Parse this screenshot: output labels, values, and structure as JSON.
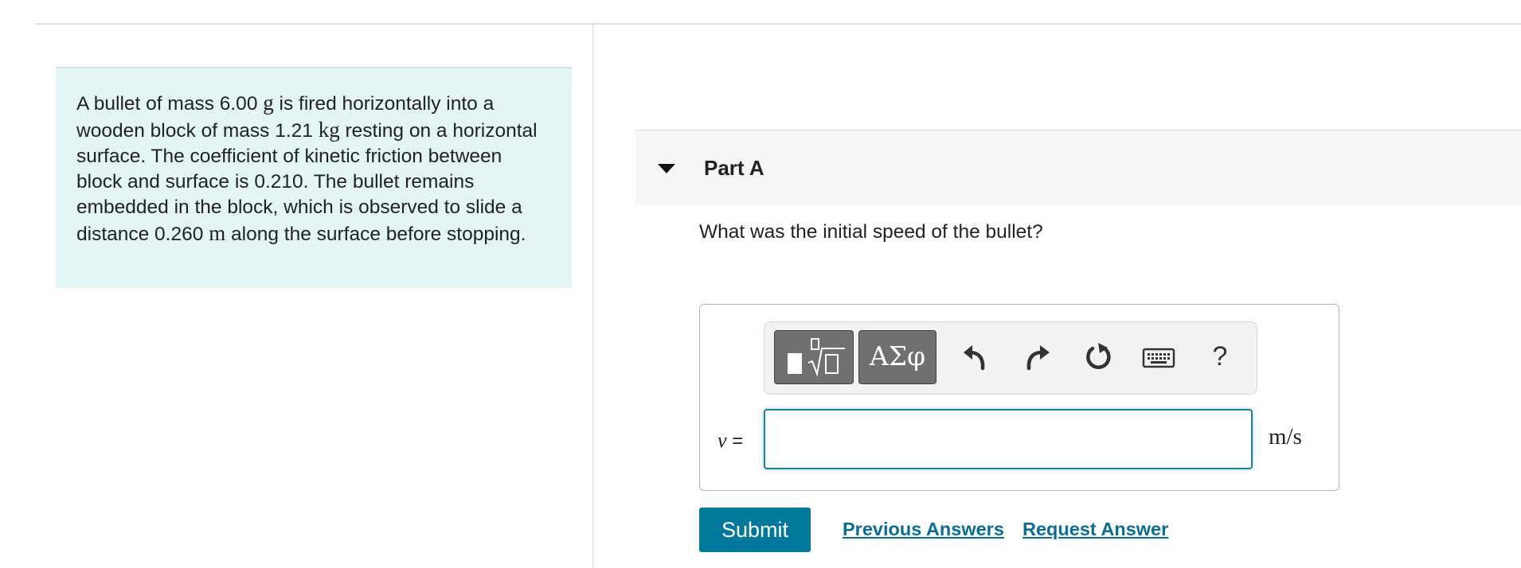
{
  "problem": {
    "seg1": "A bullet of mass 6.00 ",
    "unit_g": "g",
    "seg2": " is fired horizontally into a wooden block of mass 1.21 ",
    "unit_kg": "kg",
    "seg3": " resting on a horizontal surface. The coefficient of kinetic friction between block and surface is 0.210. The bullet remains embedded in the block, which is observed to slide a distance 0.260 ",
    "unit_m": "m",
    "seg4": " along the surface before stopping."
  },
  "part": {
    "title": "Part A",
    "question": "What was the initial speed of the bullet?"
  },
  "toolbar": {
    "symbols_label": "ΑΣφ",
    "help_label": "?",
    "icons": [
      "templates-icon",
      "undo-icon",
      "redo-icon",
      "reset-icon",
      "keyboard-icon"
    ]
  },
  "answer": {
    "variable": "v",
    "equals": "=",
    "value": "",
    "units": "m/s"
  },
  "actions": {
    "submit_label": "Submit",
    "previous_answers_label": "Previous Answers",
    "request_answer_label": "Request Answer"
  },
  "colors": {
    "problem_bg": "#e4f5f5",
    "accent": "#00789d",
    "link": "#0a6d96",
    "input_border": "#1a7fa3"
  }
}
